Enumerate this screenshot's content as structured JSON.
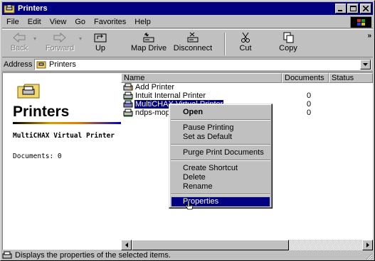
{
  "window": {
    "title": "Printers"
  },
  "menubar": {
    "items": [
      "File",
      "Edit",
      "View",
      "Go",
      "Favorites",
      "Help"
    ]
  },
  "toolbar": {
    "back": "Back",
    "forward": "Forward",
    "up": "Up",
    "map_drive": "Map Drive",
    "disconnect": "Disconnect",
    "cut": "Cut",
    "copy": "Copy",
    "more": "»"
  },
  "address": {
    "label": "Address",
    "value": "Printers"
  },
  "leftpane": {
    "heading": "Printers",
    "selected_name": "MultiCHAX Virtual Printer",
    "documents": "Documents: 0"
  },
  "list": {
    "columns": [
      "Name",
      "Documents",
      "Status"
    ],
    "rows": [
      {
        "name": "Add Printer",
        "documents": ""
      },
      {
        "name": "Intuit Internal Printer",
        "documents": "0"
      },
      {
        "name": "MultiCHAX Virtual Printer",
        "documents": "0"
      },
      {
        "name": "ndps-mop2",
        "documents": "0"
      }
    ]
  },
  "context_menu": {
    "open": "Open",
    "pause": "Pause Printing",
    "set_default": "Set as Default",
    "purge": "Purge Print Documents",
    "create_shortcut": "Create Shortcut",
    "delete": "Delete",
    "rename": "Rename",
    "properties": "Properties"
  },
  "status": {
    "text": "Displays the properties of the selected items."
  },
  "colors": {
    "title_bar": "#000080",
    "face": "#c0c0c0",
    "selection": "#000080"
  }
}
